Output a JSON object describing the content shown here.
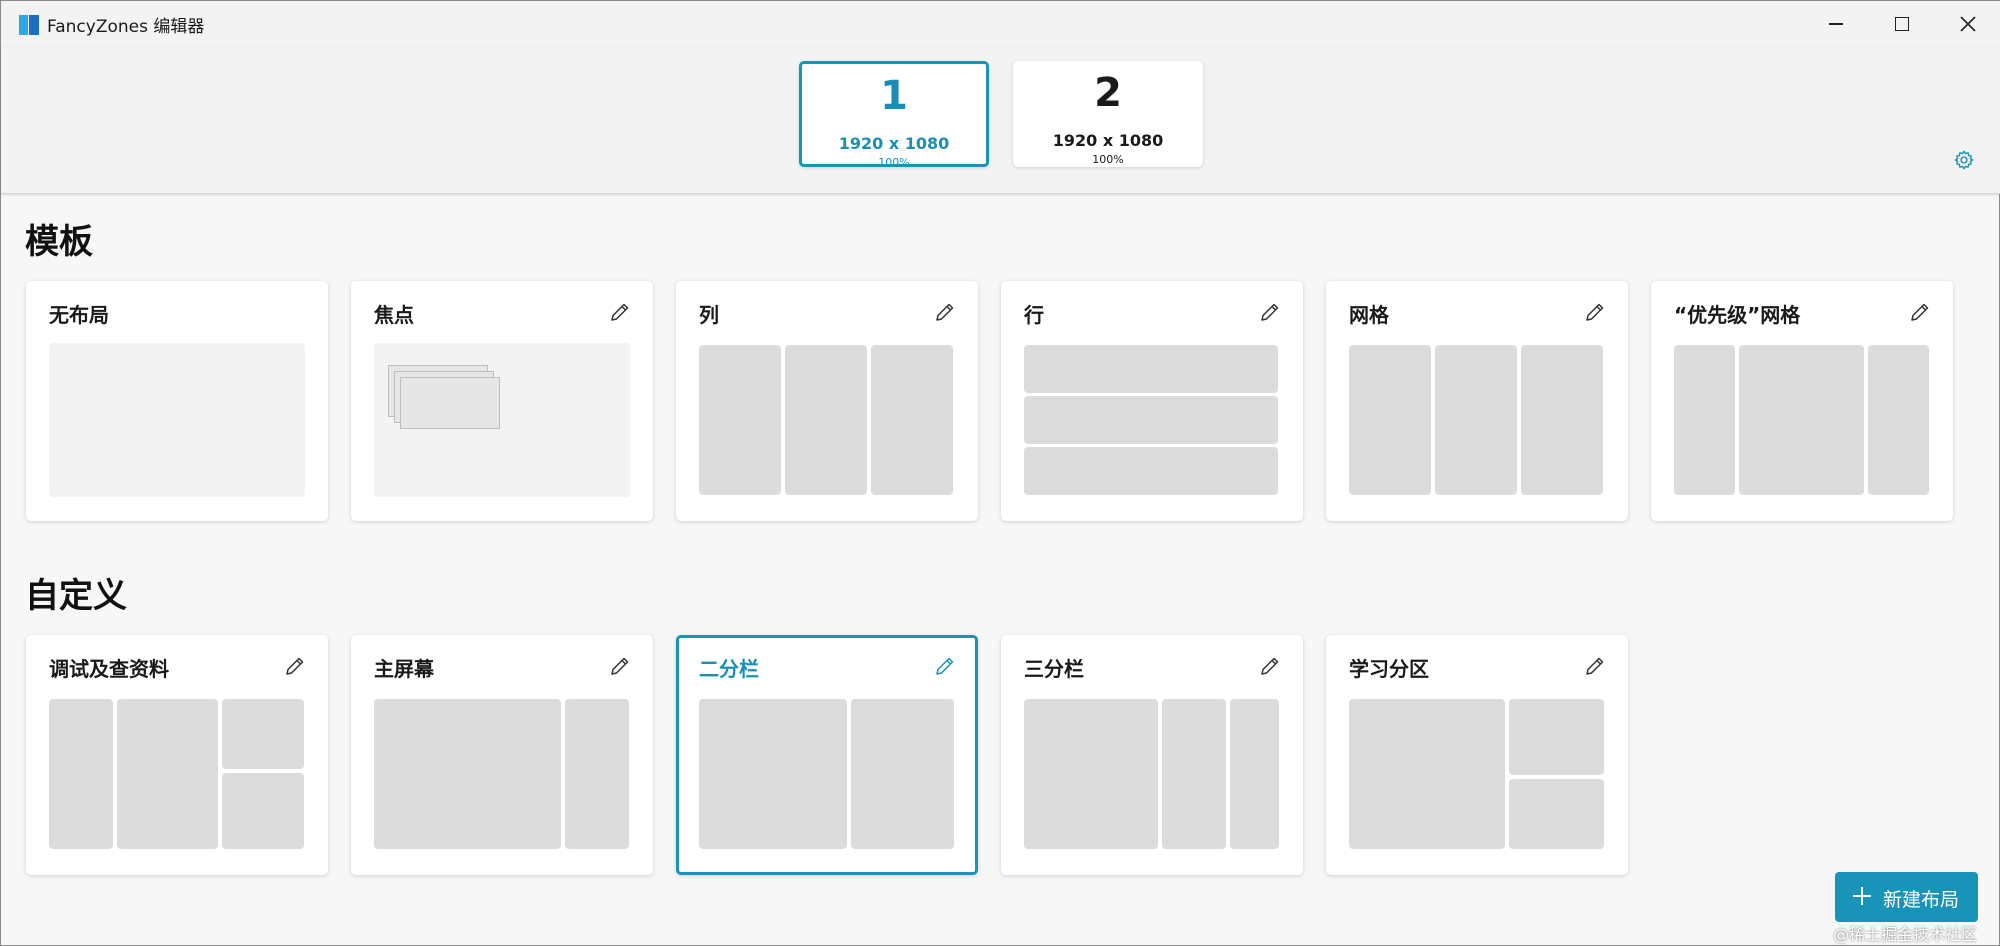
{
  "window": {
    "title": "FancyZones 编辑器",
    "controls": {
      "minimize": "minimize",
      "maximize": "maximize",
      "close": "close"
    }
  },
  "monitors": [
    {
      "number": "1",
      "resolution": "1920 x 1080",
      "scale": "100%",
      "selected": true
    },
    {
      "number": "2",
      "resolution": "1920 x 1080",
      "scale": "100%",
      "selected": false
    }
  ],
  "sections": {
    "templates_title": "模板",
    "custom_title": "自定义"
  },
  "templates": [
    {
      "name": "无布局",
      "editable": false
    },
    {
      "name": "焦点",
      "editable": true
    },
    {
      "name": "列",
      "editable": true
    },
    {
      "name": "行",
      "editable": true
    },
    {
      "name": "网格",
      "editable": true
    },
    {
      "name": "“优先级”网格",
      "editable": true
    }
  ],
  "custom_layouts": [
    {
      "name": "调试及查资料",
      "selected": false
    },
    {
      "name": "主屏幕",
      "selected": false
    },
    {
      "name": "二分栏",
      "selected": true
    },
    {
      "name": "三分栏",
      "selected": false
    },
    {
      "name": "学习分区",
      "selected": false
    }
  ],
  "new_layout_button": {
    "label": "新建布局"
  },
  "watermark": "@稀土掘金技术社区",
  "colors": {
    "accent": "#1a93b8",
    "zone": "#dcdcdc",
    "background": "#f7f7f7"
  },
  "icons": {
    "settings": "gear-icon",
    "edit": "pencil-icon",
    "add": "plus-icon"
  }
}
